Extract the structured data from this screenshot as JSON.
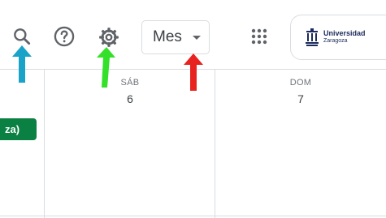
{
  "toolbar": {
    "search_icon": "search-icon",
    "help_icon": "help-icon",
    "settings_icon": "gear-icon",
    "view_select": {
      "label": "Mes"
    },
    "apps_icon": "apps-grid-icon",
    "brand": {
      "line1": "Universidad",
      "line2": "Zaragoza"
    }
  },
  "days": [
    {
      "dow": "SÁB",
      "date": "6"
    },
    {
      "dow": "DOM",
      "date": "7"
    }
  ],
  "event": {
    "label": "za)"
  },
  "annotations": {
    "colors": {
      "cyan": "#1aa3c8",
      "green": "#33e02a",
      "red": "#e8231f"
    }
  },
  "colors": {
    "event_bg": "#0b8043",
    "icon": "#5f6368",
    "border": "#dadce0"
  }
}
